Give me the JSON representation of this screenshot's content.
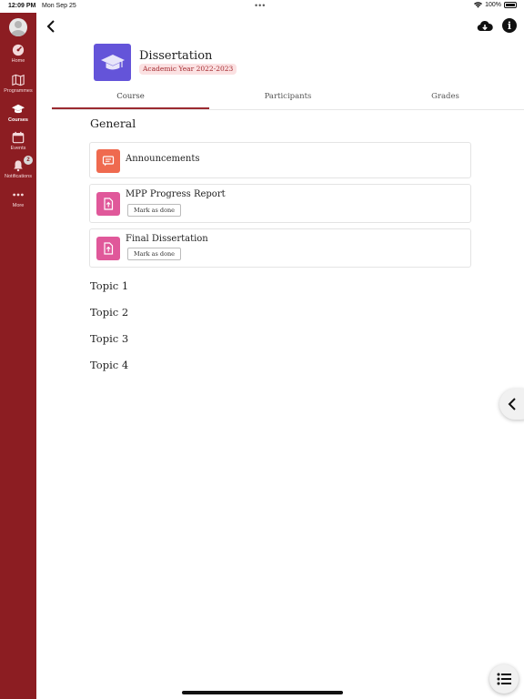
{
  "status_bar": {
    "time": "12:09 PM",
    "date": "Mon Sep 25",
    "battery": "100%"
  },
  "sidebar": {
    "items": [
      {
        "label": "Home",
        "icon": "dashboard-gauge-icon"
      },
      {
        "label": "Programmes",
        "icon": "map-icon"
      },
      {
        "label": "Courses",
        "icon": "graduation-cap-icon",
        "active": true
      },
      {
        "label": "Events",
        "icon": "calendar-icon"
      },
      {
        "label": "Notifications",
        "icon": "bell-icon",
        "badge": "2"
      },
      {
        "label": "More",
        "icon": "more-dots-icon"
      }
    ]
  },
  "course": {
    "title": "Dissertation",
    "year": "Academic Year 2022-2023",
    "icon_color": "#6454d9"
  },
  "tabs": [
    {
      "label": "Course",
      "active": true
    },
    {
      "label": "Participants"
    },
    {
      "label": "Grades"
    }
  ],
  "general": {
    "title": "General",
    "modules": [
      {
        "name": "Announcements",
        "icon": "forum-icon",
        "icon_color": "#ef6a4f"
      },
      {
        "name": "MPP Progress Report",
        "icon": "assignment-upload-icon",
        "icon_color": "#e0589a",
        "button": "Mark as done"
      },
      {
        "name": "Final Dissertation",
        "icon": "assignment-upload-icon",
        "icon_color": "#e0589a",
        "button": "Mark as done"
      }
    ]
  },
  "topics": [
    "Topic 1",
    "Topic 2",
    "Topic 3",
    "Topic 4"
  ],
  "colors": {
    "sidebar": "#8c1d22",
    "accent": "#9b2a30"
  }
}
